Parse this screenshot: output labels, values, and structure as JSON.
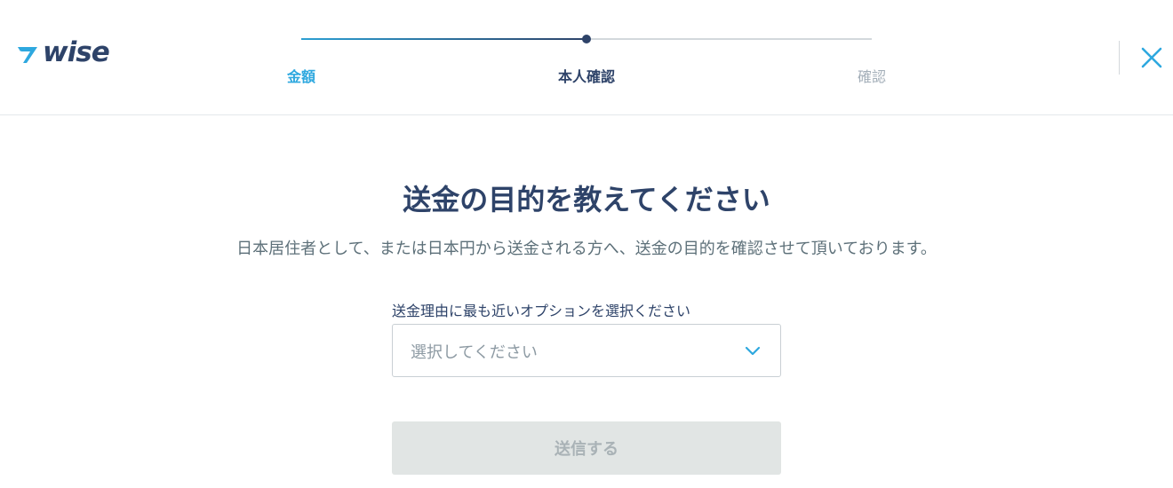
{
  "brand": {
    "name": "WISE",
    "logo_text": "wise",
    "accent": "#2ea8df",
    "navy": "#2e4369"
  },
  "stepper": {
    "steps": [
      {
        "label": "金額",
        "state": "complete"
      },
      {
        "label": "本人確認",
        "state": "current"
      },
      {
        "label": "確認",
        "state": "upcoming"
      }
    ],
    "progress": 0.5
  },
  "header": {
    "close_icon": "close-icon"
  },
  "main": {
    "title": "送金の目的を教えてください",
    "subtitle": "日本居住者として、または日本円から送金される方へ、送金の目的を確認させて頂いております。",
    "reason_field": {
      "label": "送金理由に最も近いオプションを選択ください",
      "placeholder": "選択してください",
      "icon": "chevron-down-icon"
    },
    "submit_label": "送信する"
  }
}
